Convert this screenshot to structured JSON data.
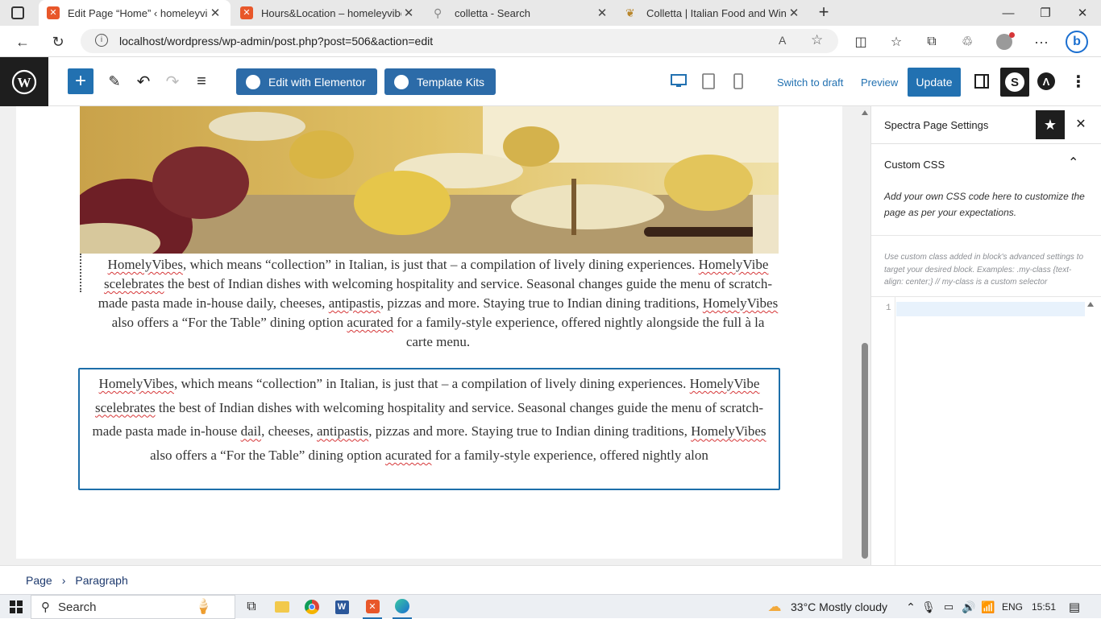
{
  "browser": {
    "tabs": [
      {
        "title": "Edit Page “Home” ‹ homeleyvibes",
        "active": true
      },
      {
        "title": "Hours&Location – homeleyvibes",
        "active": false
      },
      {
        "title": "colletta - Search",
        "active": false
      },
      {
        "title": "Colletta | Italian Food and Wine in",
        "active": false
      }
    ],
    "url": "localhost/wordpress/wp-admin/post.php?post=506&action=edit"
  },
  "toolbar": {
    "edit_with_elementor": "Edit with Elementor",
    "template_kits": "Template Kits",
    "switch_to_draft": "Switch to draft",
    "preview": "Preview",
    "update": "Update"
  },
  "content": {
    "p1": {
      "s1": "HomelyVibes",
      "t1": ", which means “collection” in Italian, is just that – a compilation of lively dining experiences.",
      "s2": "HomelyVibe",
      "s3": "scelebrates",
      "t2": " the best of Indian dishes with welcoming hospitality and service. Seasonal changes guide the menu of scratch-made pasta made in-house daily, cheeses, ",
      "s4": "antipastis",
      "t3": ", pizzas and more. Staying true to Indian dining traditions, ",
      "s5": "HomelyVibes",
      "t4": " also offers a “For the Table” dining option ",
      "s6": "acurated",
      "t5": " for a family-style experience, offered nightly alongside the full à la carte menu."
    },
    "p2": {
      "s1": "HomelyVibes",
      "t1": ", which means “collection” in Italian, is just that – a compilation of lively dining experiences.",
      "s2": "HomelyVibe",
      "s3": "scelebrates",
      "t2": " the best of Indian dishes with welcoming hospitality and service. Seasonal changes guide the menu of scratch-made pasta made in-house ",
      "s4": "dail",
      "t3": ", cheeses, ",
      "s5": "antipastis",
      "t4": ", pizzas and more. Staying true to Indian dining traditions, ",
      "s6": "HomelyVibes",
      "t5": " also offers a “For the Table” dining option ",
      "s7": "acurated",
      "t6": " for a family-style experience, offered nightly alon"
    }
  },
  "sidebar": {
    "title": "Spectra Page Settings",
    "section": "Custom CSS",
    "description": "Add your own CSS code here to customize the page as per your expectations.",
    "help": "Use custom class added in block's advanced settings to target your desired block. Examples: .my-class {text-align: center;} // my-class is a custom selector",
    "line_number": "1"
  },
  "breadcrumb": {
    "page": "Page",
    "sep": "›",
    "block": "Paragraph"
  },
  "taskbar": {
    "search": "Search",
    "weather": "33°C  Mostly cloudy",
    "lang": "ENG",
    "time": "15:51"
  },
  "colors": {
    "wp_blue": "#2271b1",
    "elementor_blue": "#2c6ba8",
    "selection_border": "#1d6ea9",
    "spell_red": "#d63638"
  }
}
